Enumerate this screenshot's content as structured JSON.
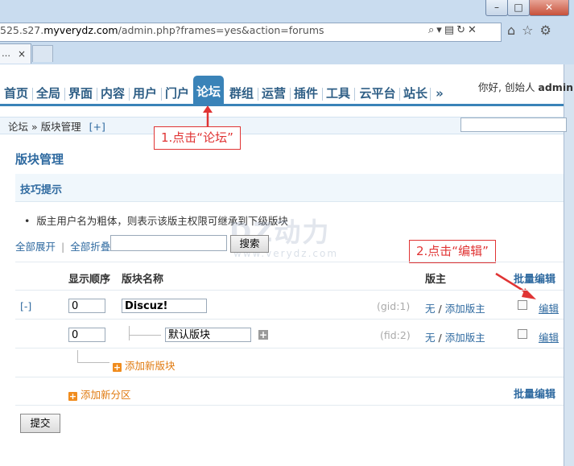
{
  "browser": {
    "url_prefix": "525.s27.",
    "url_domain": "myverydz.com",
    "url_path": "/admin.php?frames=yes&action=forums",
    "tab_label": "…",
    "tab_close": "×",
    "win_min": "–",
    "win_max": "□",
    "win_close": "✕"
  },
  "nav": {
    "items": [
      "首页",
      "全局",
      "界面",
      "内容",
      "用户",
      "门户",
      "论坛",
      "群组",
      "运营",
      "插件",
      "工具",
      "云平台",
      "站长",
      "»"
    ],
    "active_index": 6,
    "welcome_text": "你好, 创始人 ",
    "welcome_user": "admin"
  },
  "breadcrumb": {
    "path": "论坛 » 版块管理",
    "plus": "[+]"
  },
  "annotations": {
    "step1": "1.点击“论坛”",
    "step2": "2.点击“编辑”",
    "color": "#e03434"
  },
  "page": {
    "title": "版块管理",
    "tip_title": "技巧提示",
    "tip_text": "版主用户名为粗体，则表示该版主权限可继承到下级版块",
    "expand_all": "全部展开",
    "collapse_all": "全部折叠",
    "search_button": "搜索",
    "batch_edit": "批量编辑",
    "submit": "提交",
    "watermark": "DZ动力",
    "watermark_sub": "www.verydz.com"
  },
  "table": {
    "headers": {
      "order": "显示顺序",
      "name": "版块名称",
      "moderator": "版主"
    },
    "collapse_toggle": "[-]",
    "rows": [
      {
        "order": "0",
        "name": "Discuz!",
        "id": "(gid:1)",
        "mod_none": "无",
        "mod_sep": " / ",
        "add_mod": "添加版主",
        "edit": "编辑"
      },
      {
        "order": "0",
        "name": "默认版块",
        "id": "(fid:2)",
        "mod_none": "无",
        "mod_sep": " / ",
        "add_mod": "添加版主",
        "edit": "编辑"
      }
    ],
    "add_forum": "添加新版块",
    "add_category": "添加新分区"
  }
}
